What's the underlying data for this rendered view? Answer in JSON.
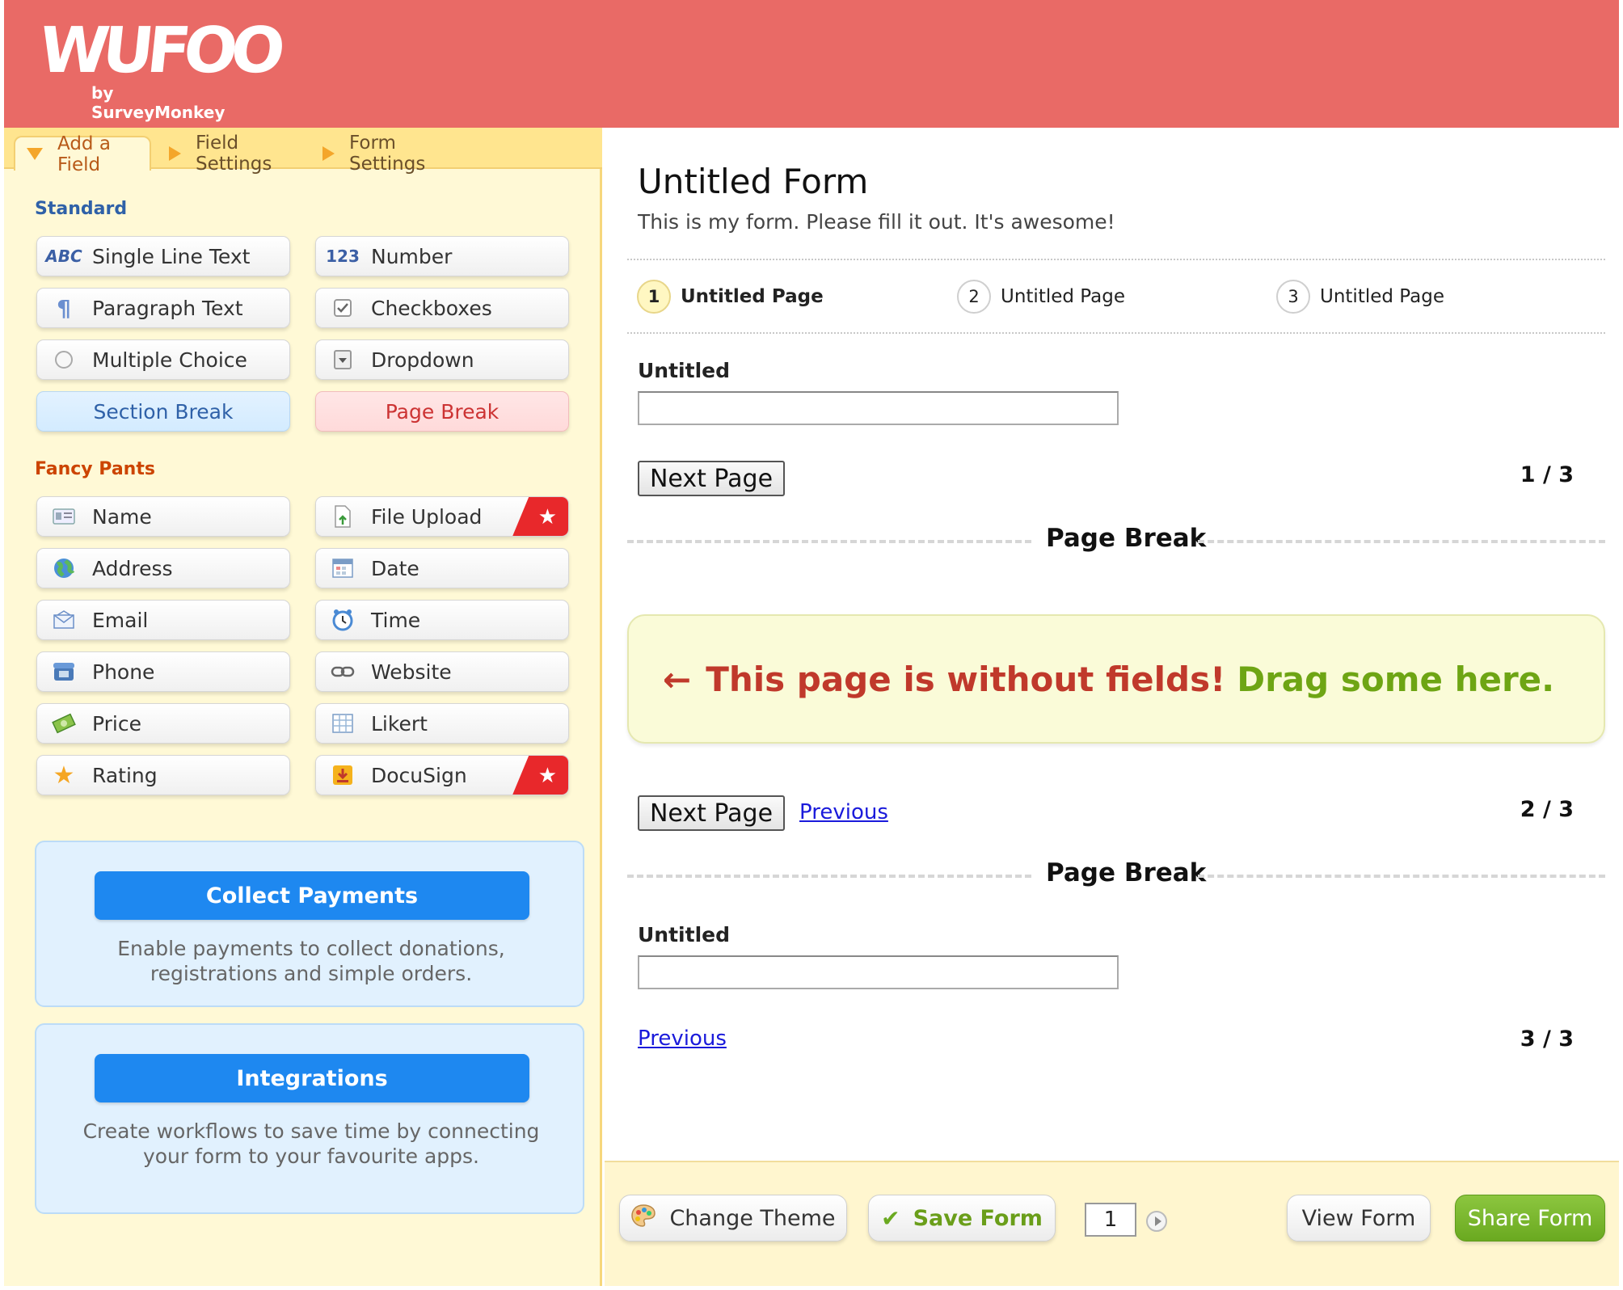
{
  "brand": {
    "logo_text": "WUFOO",
    "byline": "by SurveyMonkey"
  },
  "tabs": [
    {
      "label": "Add a Field",
      "active": true
    },
    {
      "label": "Field Settings",
      "active": false
    },
    {
      "label": "Form Settings",
      "active": false
    }
  ],
  "standard": {
    "title": "Standard",
    "fields": [
      {
        "label": "Single Line Text",
        "icon": "abc-icon"
      },
      {
        "label": "Number",
        "icon": "number-icon"
      },
      {
        "label": "Paragraph Text",
        "icon": "paragraph-icon"
      },
      {
        "label": "Checkboxes",
        "icon": "checkbox-icon"
      },
      {
        "label": "Multiple Choice",
        "icon": "radio-icon"
      },
      {
        "label": "Dropdown",
        "icon": "dropdown-icon"
      },
      {
        "label": "Section Break"
      },
      {
        "label": "Page Break"
      }
    ]
  },
  "fancy": {
    "title": "Fancy Pants",
    "fields": [
      {
        "label": "Name",
        "icon": "name-card-icon"
      },
      {
        "label": "File Upload",
        "icon": "file-upload-icon",
        "premium": true
      },
      {
        "label": "Address",
        "icon": "globe-icon"
      },
      {
        "label": "Date",
        "icon": "calendar-icon"
      },
      {
        "label": "Email",
        "icon": "envelope-icon"
      },
      {
        "label": "Time",
        "icon": "clock-icon"
      },
      {
        "label": "Phone",
        "icon": "phone-icon"
      },
      {
        "label": "Website",
        "icon": "link-icon"
      },
      {
        "label": "Price",
        "icon": "money-icon"
      },
      {
        "label": "Likert",
        "icon": "table-icon"
      },
      {
        "label": "Rating",
        "icon": "star-icon"
      },
      {
        "label": "DocuSign",
        "icon": "download-icon",
        "premium": true
      }
    ],
    "premium_glyph": "★"
  },
  "promos": {
    "payments": {
      "button": "Collect Payments",
      "text": "Enable payments to collect donations, registrations and simple orders."
    },
    "integrations": {
      "button": "Integrations",
      "text": "Create workflows to save time by connecting your form to your favourite apps."
    }
  },
  "form": {
    "title": "Untitled Form",
    "description": "This is my form. Please fill it out. It's awesome!",
    "steps": [
      {
        "num": "1",
        "label": "Untitled Page",
        "active": true
      },
      {
        "num": "2",
        "label": "Untitled Page",
        "active": false
      },
      {
        "num": "3",
        "label": "Untitled Page",
        "active": false
      }
    ],
    "field1_label": "Untitled",
    "field1_value": "",
    "field2_label": "Untitled",
    "field2_value": "",
    "next_label": "Next Page",
    "previous_label": "Previous",
    "page_break_label": "Page Break",
    "page1_count": "1 / 3",
    "page2_count": "2 / 3",
    "page3_count": "3 / 3",
    "empty_arrow": "←",
    "empty_red": "This page is without fields!",
    "empty_green": "Drag some here."
  },
  "bottom": {
    "change_theme": "Change Theme",
    "save_form": "Save Form",
    "page_input": "1",
    "view_form": "View Form",
    "share_form": "Share Form"
  },
  "colors": {
    "header": "#e96a66",
    "sidebar_bg": "#fff9d6",
    "tab_bar": "#ffe58f",
    "accent_blue": "#1e88f0",
    "share_green": "#6aa920",
    "premium_red": "#e8282b"
  }
}
